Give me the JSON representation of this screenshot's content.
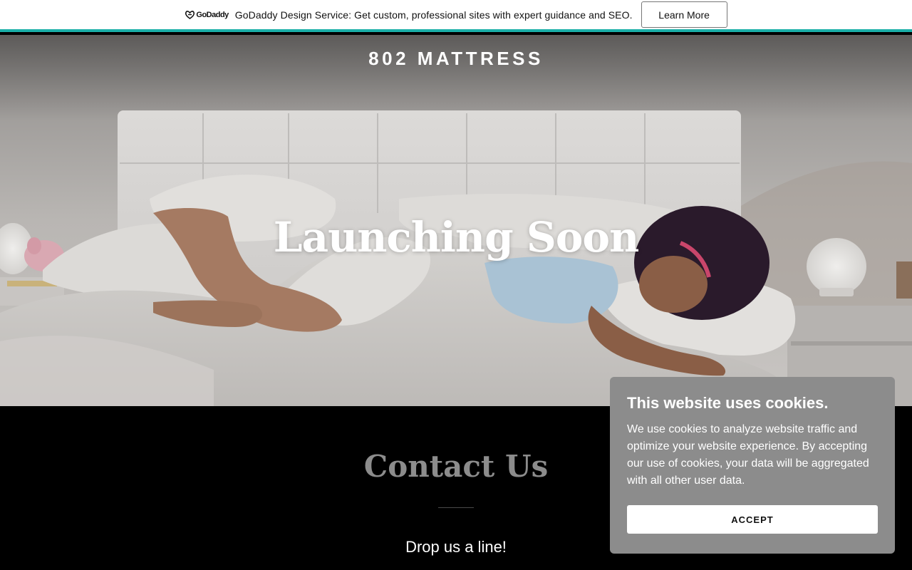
{
  "promo": {
    "brand": "GoDaddy",
    "text": "GoDaddy Design Service: Get custom, professional sites with expert guidance and SEO.",
    "button_label": "Learn More",
    "accent_color": "#1bafa8"
  },
  "hero": {
    "site_title": "802 MATTRESS",
    "heading": "Launching Soon"
  },
  "contact": {
    "title": "Contact Us",
    "subtitle": "Drop us a line!"
  },
  "cookie": {
    "title": "This website uses cookies.",
    "body": "We use cookies to analyze website traffic and optimize your website experience. By accepting our use of cookies, your data will be aggregated with all other user data.",
    "accept_label": "ACCEPT"
  }
}
